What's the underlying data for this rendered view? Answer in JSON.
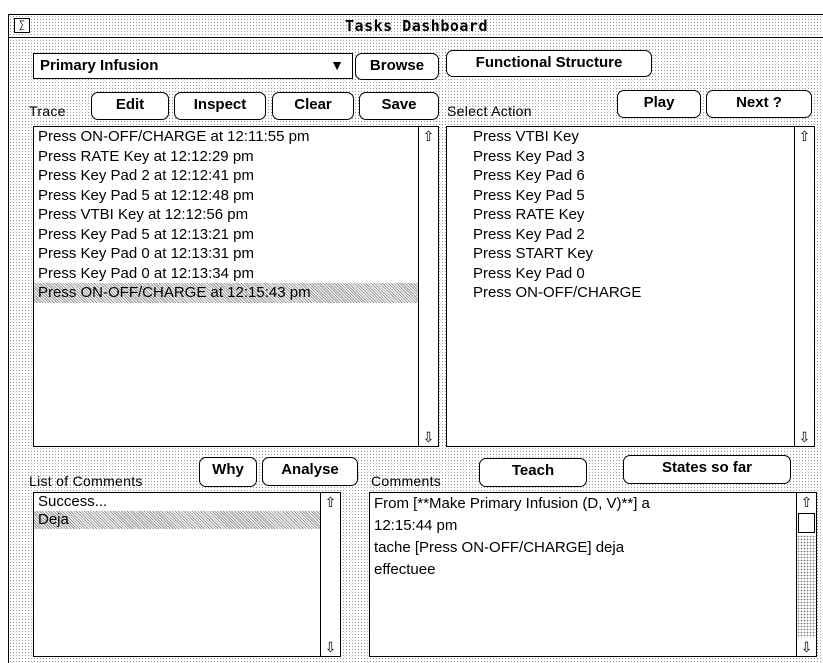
{
  "window": {
    "title": "Tasks Dashboard",
    "menu_glyph": "∑"
  },
  "top": {
    "dropdown_value": "Primary Infusion",
    "browse_label": "Browse",
    "functional_structure_label": "Functional Structure"
  },
  "trace": {
    "label": "Trace",
    "edit_label": "Edit",
    "inspect_label": "Inspect",
    "clear_label": "Clear",
    "save_label": "Save",
    "items": [
      "Press ON-OFF/CHARGE at 12:11:55 pm",
      "Press RATE Key at 12:12:29 pm",
      "Press Key Pad 2 at 12:12:41 pm",
      "Press Key Pad 5 at 12:12:48 pm",
      "Press VTBI Key at 12:12:56 pm",
      "Press Key Pad 5 at 12:13:21 pm",
      "Press Key Pad 0 at 12:13:31 pm",
      "Press Key Pad 0 at 12:13:34 pm",
      "Press ON-OFF/CHARGE at 12:15:43 pm"
    ],
    "selected_index": 8
  },
  "select_action": {
    "label": "Select Action",
    "play_label": "Play",
    "next_label": "Next ?",
    "items": [
      "Press VTBI Key",
      "Press Key Pad 3",
      "Press Key Pad 6",
      "Press Key Pad 5",
      "Press RATE Key",
      "Press Key Pad 2",
      "Press START Key",
      "Press Key Pad 0",
      "Press ON-OFF/CHARGE"
    ]
  },
  "comments_list": {
    "label": "List of Comments",
    "why_label": "Why",
    "analyse_label": "Analyse",
    "items": [
      "Success...",
      "Deja"
    ],
    "selected_index": 1
  },
  "comments": {
    "label": "Comments",
    "teach_label": "Teach",
    "states_label": "States so far",
    "lines": [
      "From [**Make Primary Infusion (D, V)**]  a",
      "12:15:44 pm",
      "tache [Press ON-OFF/CHARGE] deja",
      "effectuee"
    ]
  },
  "icons": {
    "up_arrow": "⇧",
    "down_arrow": "⇩",
    "dropdown_caret": "▼"
  }
}
